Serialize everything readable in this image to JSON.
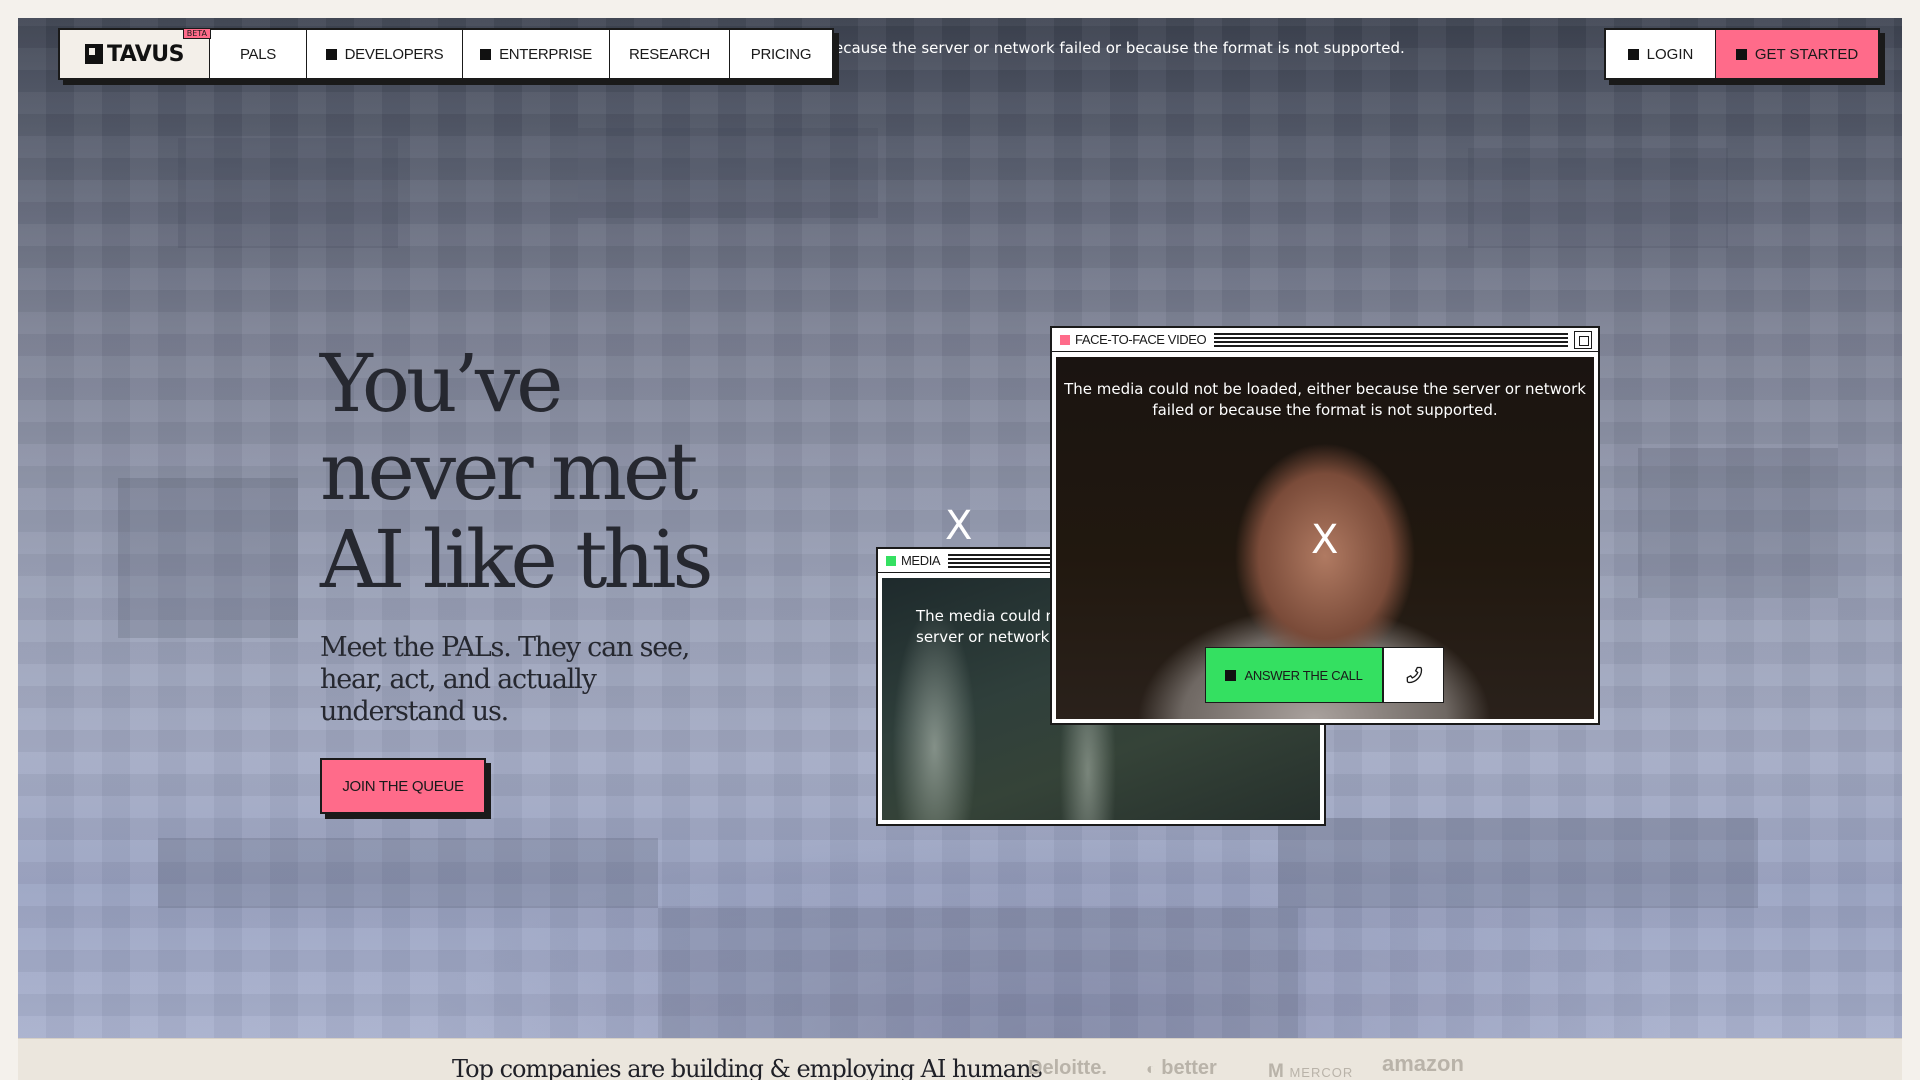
{
  "nav": {
    "logo_text": "TAVUS",
    "logo_badge": "BETA",
    "items": [
      {
        "label": "PALS"
      },
      {
        "label": "DEVELOPERS"
      },
      {
        "label": "ENTERPRISE"
      },
      {
        "label": "RESEARCH"
      },
      {
        "label": "PRICING"
      }
    ],
    "login_label": "LOGIN",
    "get_started_label": "GET STARTED"
  },
  "background_media_error": "ecause the server or network failed or because the format is not supported.",
  "hero": {
    "title_lines": [
      "You’ve",
      "never met",
      "AI like this"
    ],
    "subtitle": "Meet the PALs. They can see, hear, act, and actually understand us.",
    "cta_label": "JOIN THE QUEUE"
  },
  "media_window": {
    "title": "MEDIA",
    "error_line1": "The media could n",
    "error_line2": "server or network f",
    "close_label": "X"
  },
  "face_window": {
    "title": "FACE-TO-FACE VIDEO",
    "error_line1": "The media could not be loaded, either because the server or network",
    "error_line2": "failed or because the format is not supported.",
    "close_label": "X",
    "answer_label": "ANSWER THE CALL"
  },
  "companies": {
    "heading": "Top companies are building & employing AI humans",
    "logos": [
      "Deloitte.",
      "better",
      "MERCOR",
      "amazon"
    ]
  },
  "colors": {
    "accent_pink": "#ff6b8a",
    "accent_green": "#34e061",
    "ink": "#1a1a1a"
  }
}
